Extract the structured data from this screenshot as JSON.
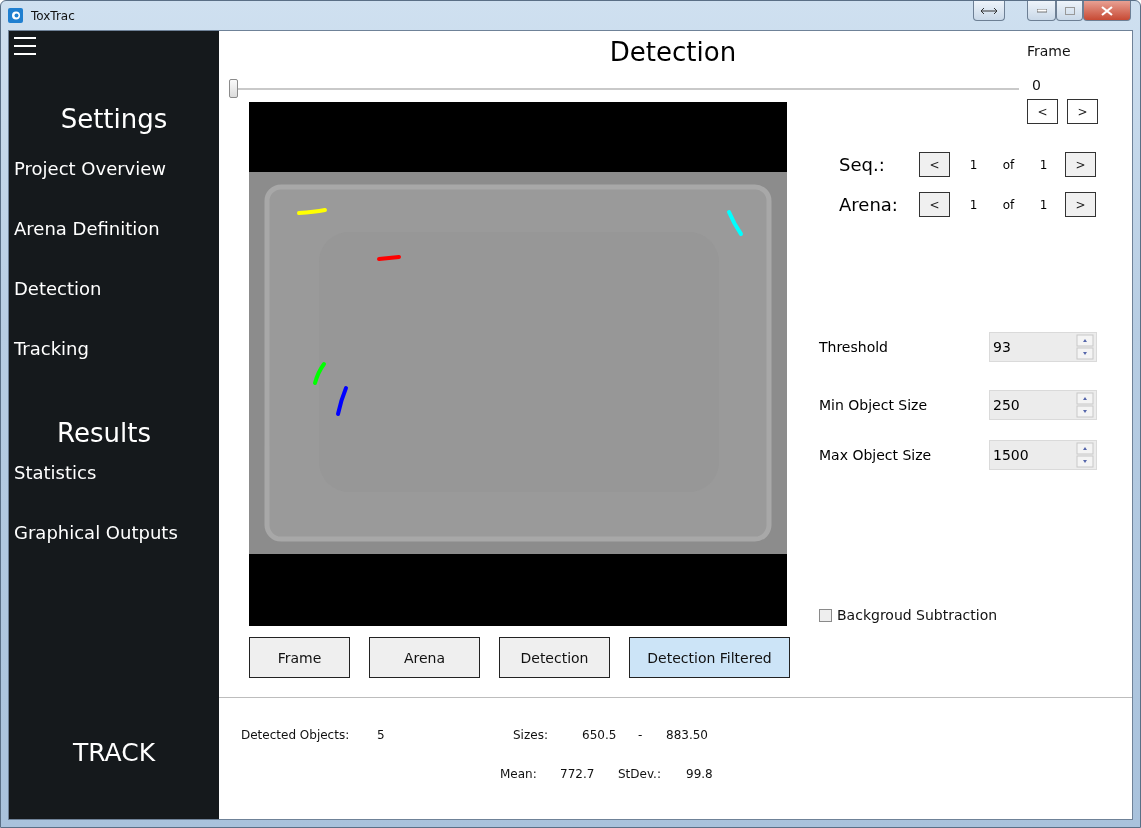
{
  "window": {
    "title": "ToxTrac"
  },
  "sidebar": {
    "sections": [
      {
        "heading": "Settings",
        "items": [
          "Project Overview",
          "Arena Definition",
          "Detection",
          "Tracking"
        ]
      },
      {
        "heading": "Results",
        "items": [
          "Statistics",
          "Graphical Outputs"
        ]
      }
    ],
    "action": "TRACK"
  },
  "main": {
    "title": "Detection",
    "frame": {
      "label": "Frame",
      "value": "0",
      "level": 0,
      "prev": "<",
      "next": ">"
    },
    "navigators": [
      {
        "label": "Seq.:",
        "prev": "<",
        "current": "1",
        "of": "of",
        "total": "1",
        "next": ">"
      },
      {
        "label": "Arena:",
        "prev": "<",
        "current": "1",
        "of": "of",
        "total": "1",
        "next": ">"
      }
    ],
    "parameters": [
      {
        "label": "Threshold",
        "value": "93"
      },
      {
        "label": "Min Object Size",
        "value": "250"
      },
      {
        "label": "Max Object Size",
        "value": "1500"
      }
    ],
    "background_subtraction": {
      "label": "Backgroud Subtraction",
      "checked": false
    },
    "view_buttons": [
      {
        "label": "Frame",
        "selected": false
      },
      {
        "label": "Arena",
        "selected": false
      },
      {
        "label": "Detection",
        "selected": false
      },
      {
        "label": "Detection Filtered",
        "selected": true
      }
    ],
    "stats": {
      "detected_label": "Detected Objects:",
      "detected_value": "5",
      "sizes_label": "Sizes:",
      "sizes_min": "650.5",
      "sizes_separator": "-",
      "sizes_max": "883.50",
      "mean_label": "Mean:",
      "mean_value": "772.7",
      "stdev_label": "StDev.:",
      "stdev_value": "99.8"
    }
  }
}
